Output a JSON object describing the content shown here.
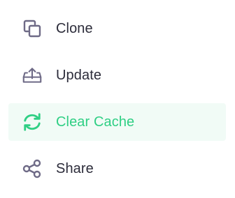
{
  "menu": {
    "items": [
      {
        "label": "Clone",
        "icon": "clone-icon",
        "active": false
      },
      {
        "label": "Update",
        "icon": "upload-tray-icon",
        "active": false
      },
      {
        "label": "Clear Cache",
        "icon": "refresh-icon",
        "active": true
      },
      {
        "label": "Share",
        "icon": "share-icon",
        "active": false
      }
    ]
  },
  "colors": {
    "text": "#2c2c3a",
    "icon": "#6e6a86",
    "accent": "#2fcf84",
    "active_background": "#f1fbf6"
  }
}
